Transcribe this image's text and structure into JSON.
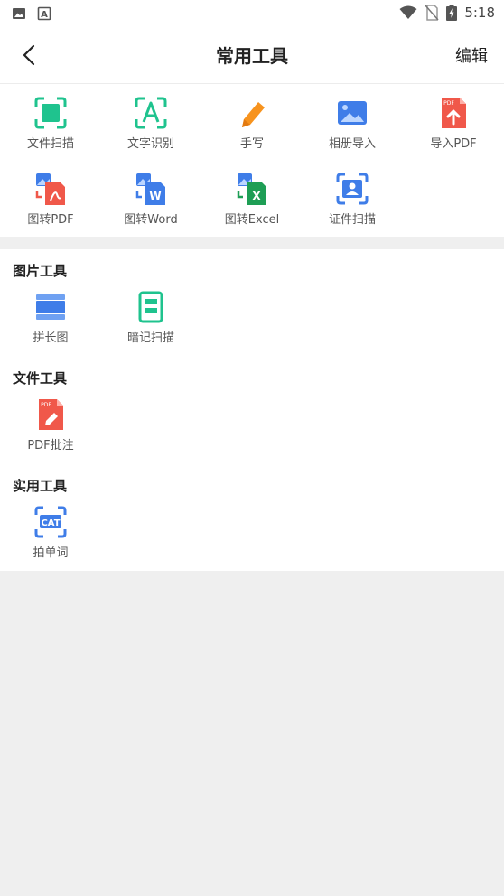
{
  "status_bar": {
    "time": "5:18"
  },
  "header": {
    "title": "常用工具",
    "edit_label": "编辑"
  },
  "common_tools": [
    {
      "label": "文件扫描",
      "icon": "scan-icon"
    },
    {
      "label": "文字识别",
      "icon": "text-recognition-icon"
    },
    {
      "label": "手写",
      "icon": "pencil-icon"
    },
    {
      "label": "相册导入",
      "icon": "photo-album-icon"
    },
    {
      "label": "导入PDF",
      "icon": "pdf-upload-icon"
    },
    {
      "label": "图转PDF",
      "icon": "image-to-pdf-icon"
    },
    {
      "label": "图转Word",
      "icon": "image-to-word-icon"
    },
    {
      "label": "图转Excel",
      "icon": "image-to-excel-icon"
    },
    {
      "label": "证件扫描",
      "icon": "id-card-scan-icon"
    }
  ],
  "sections": [
    {
      "title": "图片工具",
      "tools": [
        {
          "label": "拼长图",
          "icon": "long-image-icon"
        },
        {
          "label": "暗记扫描",
          "icon": "note-scan-icon"
        }
      ]
    },
    {
      "title": "文件工具",
      "tools": [
        {
          "label": "PDF批注",
          "icon": "pdf-annotate-icon"
        }
      ]
    },
    {
      "title": "实用工具",
      "tools": [
        {
          "label": "拍单词",
          "icon": "word-capture-icon"
        }
      ]
    }
  ],
  "colors": {
    "green": "#1fc38e",
    "orange": "#f7931e",
    "red": "#f0584a",
    "blue": "#3f7de8",
    "excel_green": "#1e9e55",
    "background": "#efefef"
  }
}
